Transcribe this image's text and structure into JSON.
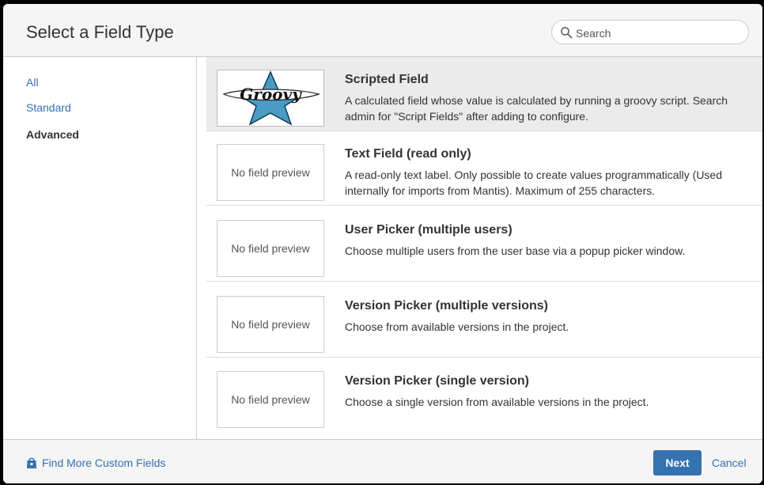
{
  "dialog": {
    "title": "Select a Field Type"
  },
  "search": {
    "placeholder": "Search",
    "icon": "search-icon"
  },
  "sidebar": {
    "items": [
      {
        "label": "All",
        "active": false
      },
      {
        "label": "Standard",
        "active": false
      },
      {
        "label": "Advanced",
        "active": true
      }
    ]
  },
  "fields": [
    {
      "title": "Scripted Field",
      "description": "A calculated field whose value is calculated by running a groovy script. Search admin for \"Script Fields\" after adding to configure.",
      "preview": "groovy-logo",
      "preview_text": "Groovy",
      "selected": true
    },
    {
      "title": "Text Field (read only)",
      "description": "A read-only text label. Only possible to create values programmatically (Used internally for imports from Mantis). Maximum of 255 characters.",
      "preview_text": "No field preview",
      "selected": false
    },
    {
      "title": "User Picker (multiple users)",
      "description": "Choose multiple users from the user base via a popup picker window.",
      "preview_text": "No field preview",
      "selected": false
    },
    {
      "title": "Version Picker (multiple versions)",
      "description": "Choose from available versions in the project.",
      "preview_text": "No field preview",
      "selected": false
    },
    {
      "title": "Version Picker (single version)",
      "description": "Choose a single version from available versions in the project.",
      "preview_text": "No field preview",
      "selected": false
    }
  ],
  "footer": {
    "find_more_label": "Find More Custom Fields",
    "find_more_icon": "shopping-bag-icon",
    "next_label": "Next",
    "cancel_label": "Cancel"
  },
  "colors": {
    "link": "#3572b0",
    "primary_button": "#3572b0",
    "selected_row": "#ebebeb",
    "groovy_star": "#4a9bc4"
  }
}
